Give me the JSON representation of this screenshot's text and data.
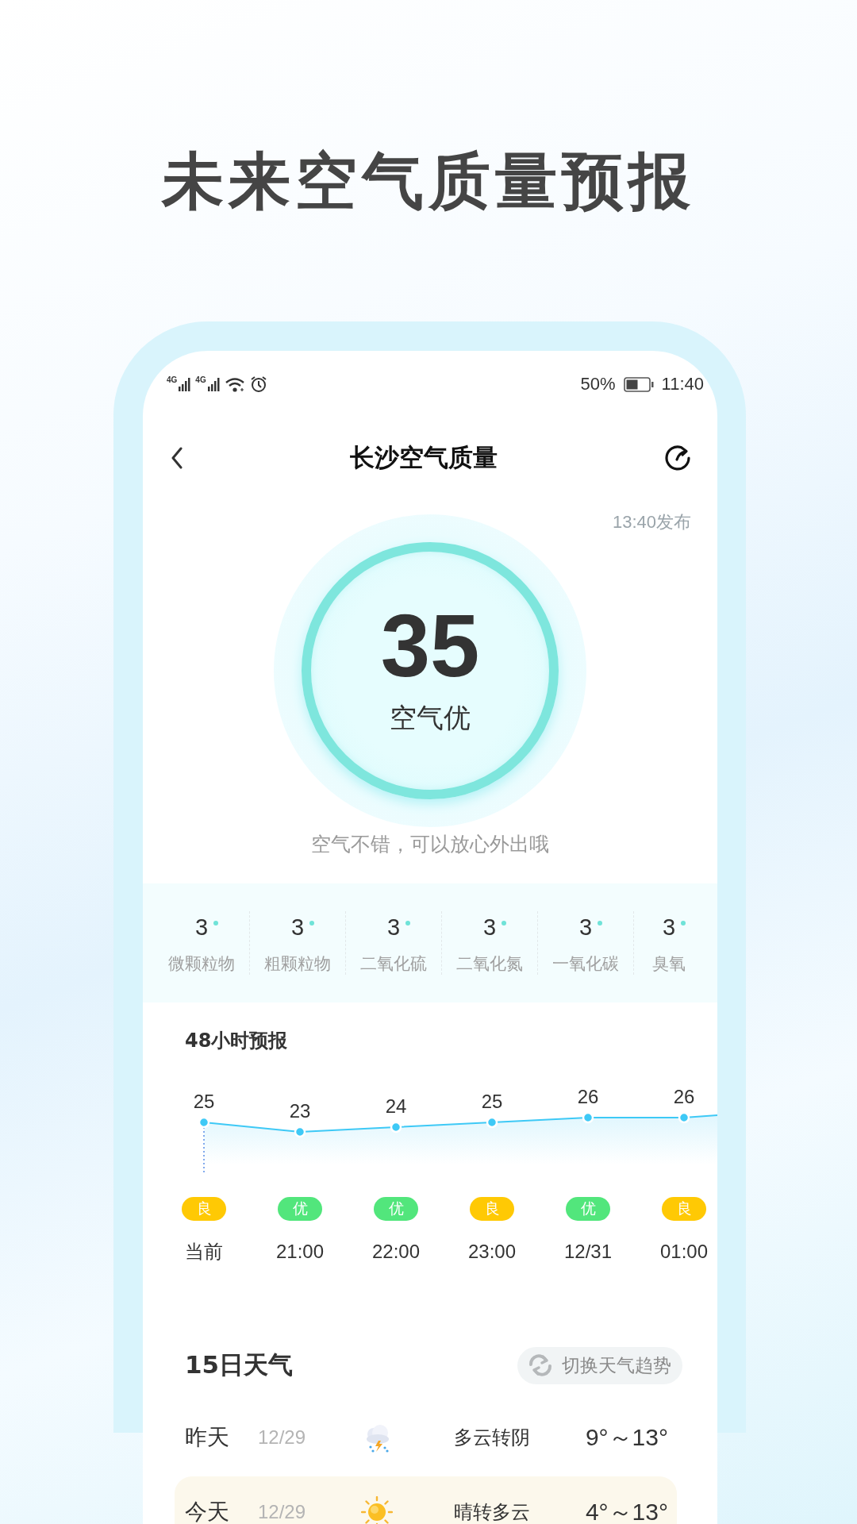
{
  "headline": "未来空气质量预报",
  "status_bar": {
    "network_labels": [
      "4G",
      "4G"
    ],
    "battery_text": "50%",
    "time": "11:40"
  },
  "nav": {
    "title": "长沙空气质量"
  },
  "published": "13:40发布",
  "aqi": {
    "value": "35",
    "label": "空气优",
    "advice": "空气不错，可以放心外出哦"
  },
  "pollutants": [
    {
      "value": "3",
      "name": "微颗粒物",
      "color": "#6fe3d8"
    },
    {
      "value": "3",
      "name": "粗颗粒物",
      "color": "#6fe3d8"
    },
    {
      "value": "3",
      "name": "二氧化硫",
      "color": "#6fe3d8"
    },
    {
      "value": "3",
      "name": "二氧化氮",
      "color": "#6fe3d8"
    },
    {
      "value": "3",
      "name": "一氧化碳",
      "color": "#6fe3d8"
    },
    {
      "value": "3",
      "name": "臭氧",
      "color": "#6fe3d8"
    }
  ],
  "forecast": {
    "title": "48小时预报",
    "chart_data": {
      "type": "line",
      "categories": [
        "当前",
        "21:00",
        "22:00",
        "23:00",
        "12/31",
        "01:00"
      ],
      "series": [
        {
          "color": "#3ec9f6",
          "marker": "circle",
          "values": [
            25,
            23,
            24,
            25,
            26,
            26
          ]
        }
      ],
      "data_labels": true
    },
    "grades": [
      {
        "label": "良",
        "color": "#ffc904"
      },
      {
        "label": "优",
        "color": "#52e67c"
      },
      {
        "label": "优",
        "color": "#52e67c"
      },
      {
        "label": "良",
        "color": "#ffc904"
      },
      {
        "label": "优",
        "color": "#52e67c"
      },
      {
        "label": "良",
        "color": "#ffc904"
      }
    ]
  },
  "daily": {
    "title": "15日天气",
    "switch_button": "切换天气趋势",
    "rows": [
      {
        "day": "昨天",
        "date": "12/29",
        "kind": "thunderstorm",
        "desc": "多云转阴",
        "temp": "9°～13°",
        "selected": false
      },
      {
        "day": "今天",
        "date": "12/29",
        "kind": "sunny",
        "desc": "晴转多云",
        "temp": "4°～13°",
        "selected": true
      }
    ]
  }
}
